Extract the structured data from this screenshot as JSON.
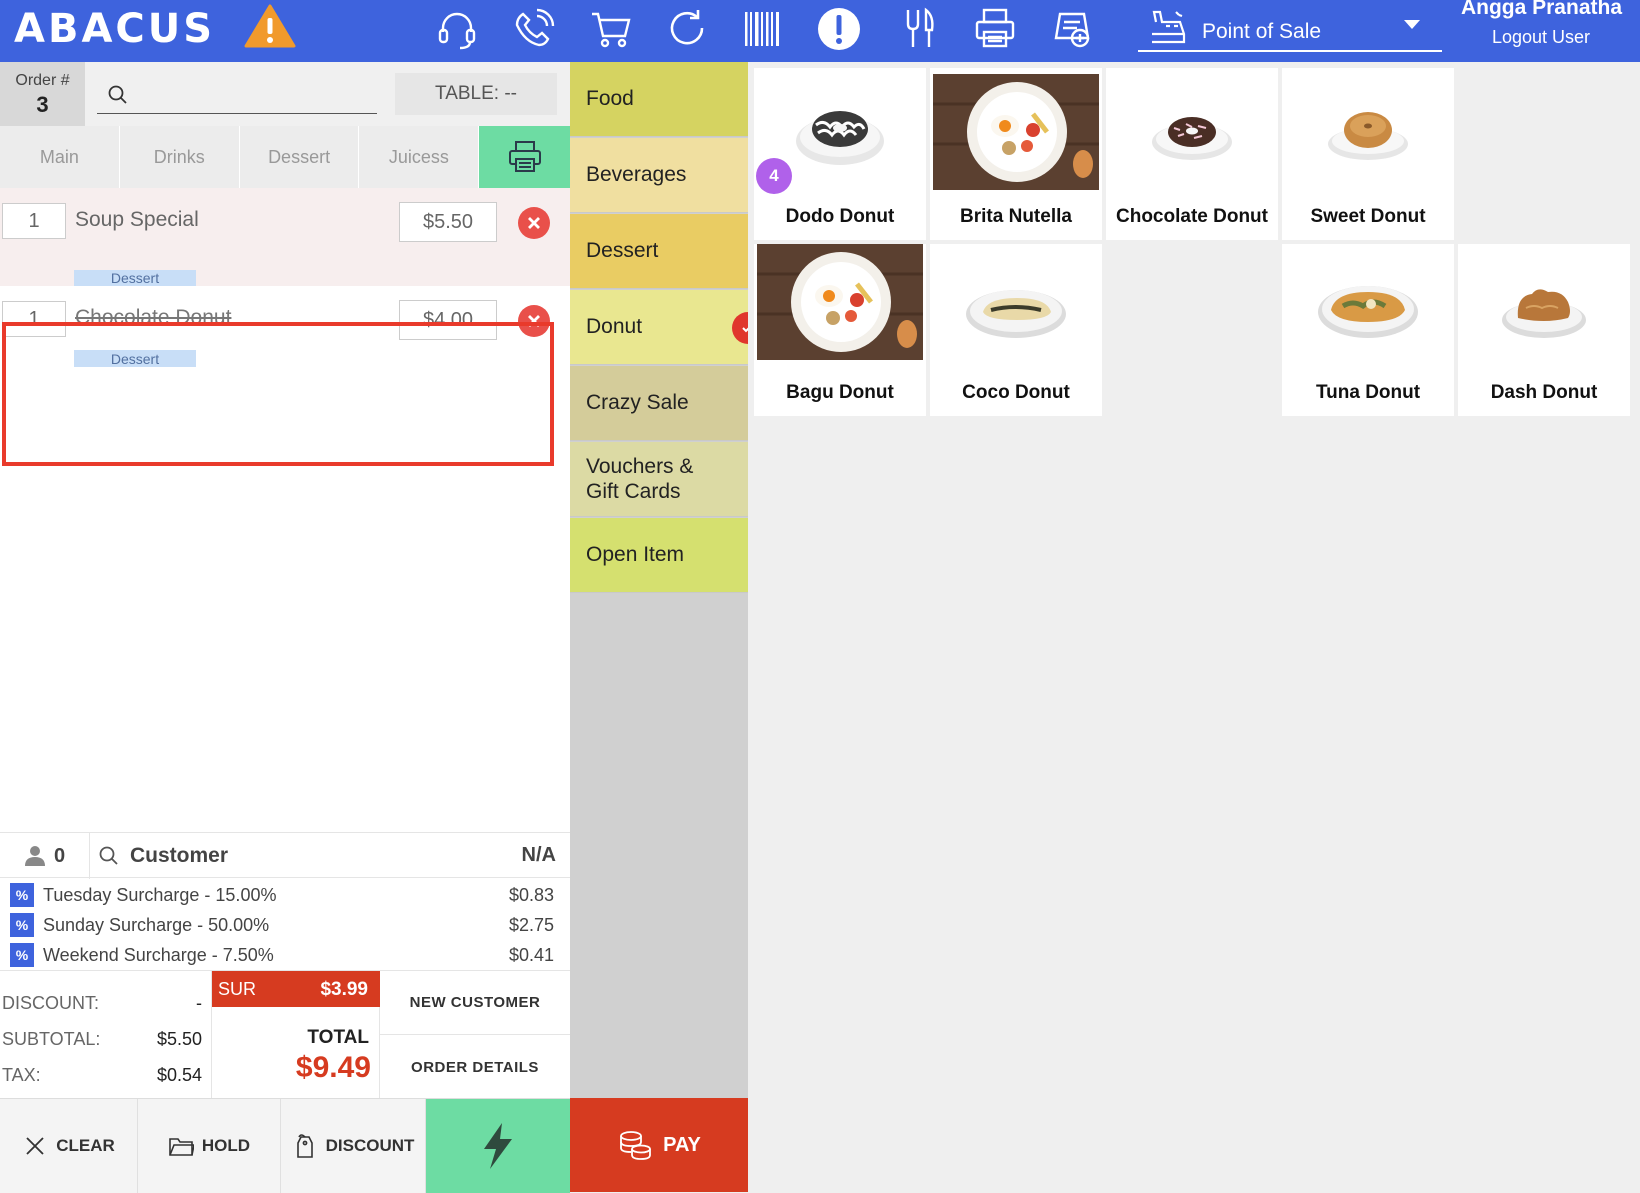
{
  "header": {
    "logo": "ABACUS",
    "mode_label": "Point of Sale",
    "user_name": "Angga Pranatha",
    "logout_label": "Logout User",
    "accent_color": "#3e63dd",
    "toolbar_icons": [
      "headset-icon",
      "phone-icon",
      "cart-icon",
      "refresh-icon",
      "barcode-icon",
      "alert-icon",
      "cutlery-icon",
      "printer-icon",
      "receipt-add-icon"
    ]
  },
  "order": {
    "order_label": "Order #",
    "order_number": "3",
    "search_placeholder": "",
    "table_label": "TABLE: --",
    "course_tabs": [
      "Main",
      "Drinks",
      "Dessert",
      "Juicess"
    ],
    "lines": [
      {
        "qty": "1",
        "name": "Soup Special",
        "price": "$5.50",
        "course": "Dessert"
      },
      {
        "qty": "1",
        "name": "Chocolate Donut",
        "price": "$4.00",
        "course": "Dessert"
      }
    ],
    "guests": "0",
    "customer_label": "Customer",
    "customer_value": "N/A",
    "surcharges": [
      {
        "badge": "%",
        "name": "Tuesday Surcharge  - 15.00%",
        "amount": "$0.83"
      },
      {
        "badge": "%",
        "name": "Sunday Surcharge - 50.00%",
        "amount": "$2.75"
      },
      {
        "badge": "%",
        "name": "Weekend Surcharge  - 7.50%",
        "amount": "$0.41"
      }
    ],
    "discount_label": "DISCOUNT:",
    "discount_value": "-",
    "subtotal_label": "SUBTOTAL:",
    "subtotal_value": "$5.50",
    "tax_label": "TAX:",
    "tax_value": "$0.54",
    "sur_label": "SUR",
    "sur_value": "$3.99",
    "total_label": "TOTAL",
    "total_value": "$9.49",
    "new_customer_label": "NEW CUSTOMER",
    "order_details_label": "ORDER DETAILS"
  },
  "actions": {
    "clear_label": "CLEAR",
    "hold_label": "HOLD",
    "discount_label": "DISCOUNT",
    "pay_label": "PAY"
  },
  "categories": [
    {
      "label": "Food",
      "color": "#d5d361"
    },
    {
      "label": "Beverages",
      "color": "#f0dfa0"
    },
    {
      "label": "Dessert",
      "color": "#e9cc63"
    },
    {
      "label": "Donut",
      "color": "#e9e790",
      "selected": true
    },
    {
      "label": "Crazy Sale",
      "color": "#d4cc9a"
    },
    {
      "label": "Vouchers & Gift Cards",
      "color": "#dcdaa4"
    },
    {
      "label": "Open Item",
      "color": "#d5e06f"
    }
  ],
  "products": [
    {
      "name": "Dodo Donut",
      "badge": "4"
    },
    {
      "name": "Brita Nutella"
    },
    {
      "name": "Chocolate Donut"
    },
    {
      "name": "Sweet Donut"
    },
    {
      "name": "Bagu Donut"
    },
    {
      "name": "Coco Donut"
    },
    {
      "name": "Tuna Donut"
    },
    {
      "name": "Dash Donut"
    }
  ]
}
